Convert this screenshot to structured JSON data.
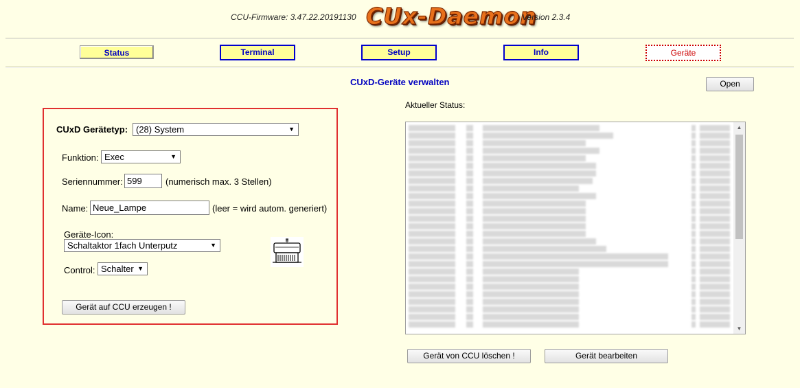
{
  "header": {
    "firmware": "CCU-Firmware: 3.47.22.20191130",
    "logo": "CUx-Daemon",
    "version": "Version 2.3.4"
  },
  "nav": {
    "status": "Status",
    "terminal": "Terminal",
    "setup": "Setup",
    "info": "Info",
    "geraete": "Geräte"
  },
  "page_title": "CUxD-Geräte verwalten",
  "open_button": "Open",
  "form": {
    "device_type_label": "CUxD Gerätetyp:",
    "device_type_value": "(28) System",
    "function_label": "Funktion:",
    "function_value": "Exec",
    "serial_label": "Seriennummer:",
    "serial_value": "599",
    "serial_hint": "(numerisch max. 3 Stellen)",
    "name_label": "Name:",
    "name_value": "Neue_Lampe",
    "name_hint": "(leer = wird autom. generiert)",
    "icon_label": "Geräte-Icon:",
    "icon_value": "Schaltaktor 1fach Unterputz",
    "control_label": "Control:",
    "control_value": "Schalter",
    "create_button": "Gerät auf CCU erzeugen !"
  },
  "status": {
    "label": "Aktueller Status:"
  },
  "actions": {
    "delete_button": "Gerät von CCU löschen !",
    "edit_button": "Gerät bearbeiten"
  },
  "colors": {
    "background": "#ffffe6",
    "nav_active_bg": "#ffff99",
    "nav_border": "#0000cc",
    "nav_current": "#cc0000",
    "title": "#0000c0",
    "highlight_box": "#e03030"
  }
}
